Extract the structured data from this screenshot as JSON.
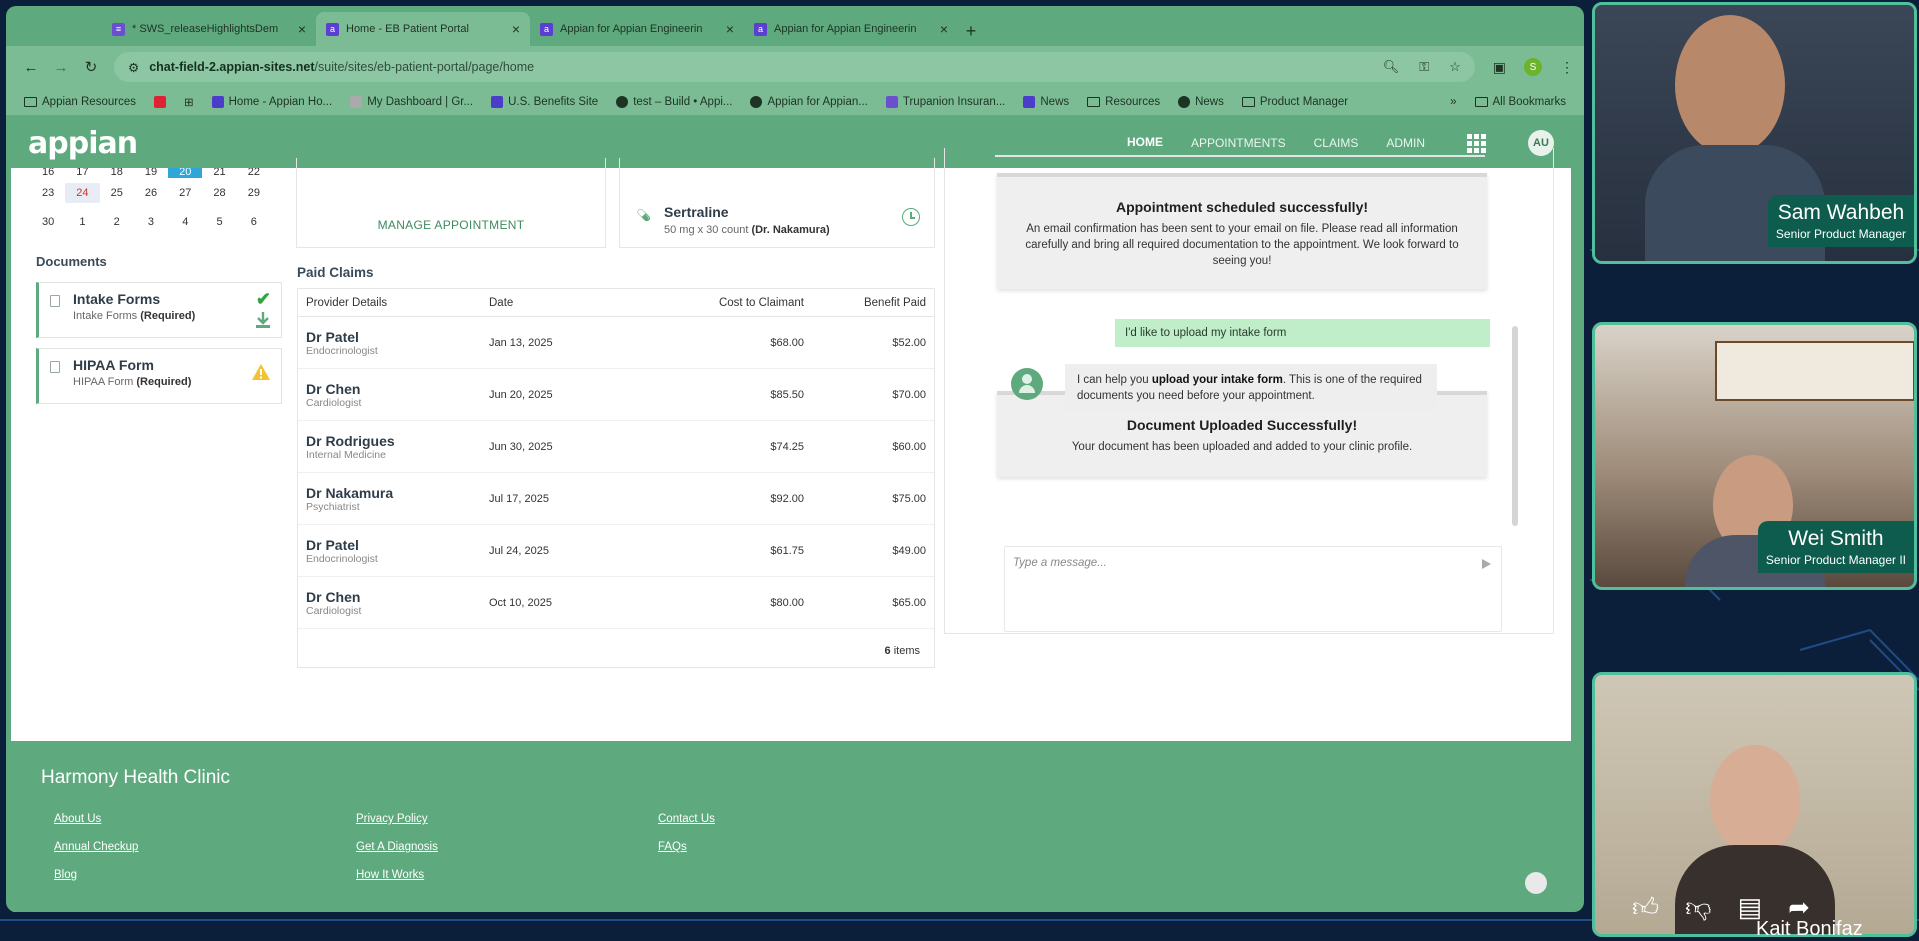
{
  "browser": {
    "tabs": [
      {
        "title": "* SWS_releaseHighlightsDem",
        "favicon": "doc-icon",
        "active": false
      },
      {
        "title": "Home - EB Patient Portal",
        "favicon": "appian-icon",
        "active": true
      },
      {
        "title": "Appian for Appian Engineerin",
        "favicon": "appian-icon",
        "active": false
      },
      {
        "title": "Appian for Appian Engineerin",
        "favicon": "appian-icon",
        "active": false
      }
    ],
    "url_host": "chat-field-2.appian-sites.net",
    "url_path": "/suite/sites/eb-patient-portal/page/home",
    "profile_initial": "S",
    "bookmarks": [
      "Appian Resources",
      "Home - Appian Ho...",
      "My Dashboard | Gr...",
      "U.S. Benefits Site",
      "test – Build • Appi...",
      "Appian for Appian...",
      "Trupanion Insuran...",
      "News",
      "Resources",
      "News",
      "Product Manager"
    ],
    "all_bookmarks": "All Bookmarks",
    "more_bookmarks": "»"
  },
  "app": {
    "logo": "appian",
    "nav": [
      {
        "label": "HOME",
        "active": true
      },
      {
        "label": "APPOINTMENTS",
        "active": false
      },
      {
        "label": "CLAIMS",
        "active": false
      },
      {
        "label": "ADMIN",
        "active": false
      }
    ],
    "avatar": "AU"
  },
  "calendar": {
    "partial_row": [
      "16",
      "17",
      "18",
      "19",
      "20",
      "21",
      "22"
    ],
    "rows": [
      [
        "23",
        "24",
        "25",
        "26",
        "27",
        "28",
        "29"
      ],
      [
        "30",
        "1",
        "2",
        "3",
        "4",
        "5",
        "6"
      ]
    ],
    "today": "24"
  },
  "documents": {
    "title": "Documents",
    "items": [
      {
        "name": "Intake Forms",
        "type": "Intake Forms",
        "required": "(Required)",
        "status": "complete"
      },
      {
        "name": "HIPAA Form",
        "type": "HIPAA Form",
        "required": "(Required)",
        "status": "warning"
      }
    ]
  },
  "appointment": {
    "manage_label": "MANAGE APPOINTMENT"
  },
  "medication": {
    "name": "Sertraline",
    "dosage": "50 mg x 30 count",
    "doctor": "(Dr. Nakamura)"
  },
  "claims": {
    "title": "Paid Claims",
    "headers": [
      "Provider Details",
      "Date",
      "Cost to Claimant",
      "Benefit Paid"
    ],
    "rows": [
      {
        "provider": "Dr Patel",
        "specialty": "Endocrinologist",
        "date": "Jan 13, 2025",
        "cost": "$68.00",
        "benefit": "$52.00"
      },
      {
        "provider": "Dr Chen",
        "specialty": "Cardiologist",
        "date": "Jun 20, 2025",
        "cost": "$85.50",
        "benefit": "$70.00"
      },
      {
        "provider": "Dr Rodrigues",
        "specialty": "Internal Medicine",
        "date": "Jun 30, 2025",
        "cost": "$74.25",
        "benefit": "$60.00"
      },
      {
        "provider": "Dr Nakamura",
        "specialty": "Psychiatrist",
        "date": "Jul 17, 2025",
        "cost": "$92.00",
        "benefit": "$75.00"
      },
      {
        "provider": "Dr Patel",
        "specialty": "Endocrinologist",
        "date": "Jul 24, 2025",
        "cost": "$61.75",
        "benefit": "$49.00"
      },
      {
        "provider": "Dr Chen",
        "specialty": "Cardiologist",
        "date": "Oct 10, 2025",
        "cost": "$80.00",
        "benefit": "$65.00"
      }
    ],
    "count": "6",
    "count_label": "items"
  },
  "chat": {
    "scheduled_title": "Appointment scheduled successfully!",
    "scheduled_text": "An email confirmation has been sent to your email on file.  Please read all information carefully and bring all required documentation to the appointment.  We look forward to seeing you!",
    "user_message": "I'd like to upload my intake form",
    "bot_pre": "I can help you ",
    "bot_bold": "upload your intake form",
    "bot_post": ". This is one of the required documents you need before your appointment.",
    "uploaded_title": "Document Uploaded Successfully!",
    "uploaded_text": "Your document has been uploaded and added to your clinic profile.",
    "input_placeholder": "Type a message..."
  },
  "footer": {
    "clinic": "Harmony Health Clinic",
    "links": [
      "About Us",
      "Privacy Policy",
      "Contact Us",
      "Annual Checkup",
      "Get A Diagnosis",
      "FAQs",
      "Blog",
      "How It Works"
    ]
  },
  "participants": [
    {
      "name": "Sam Wahbeh",
      "role": "Senior Product Manager"
    },
    {
      "name": "Wei Smith",
      "role": "Senior Product Manager II"
    },
    {
      "name": "Kait Bonifaz",
      "role": ""
    }
  ],
  "colors": {
    "brand_green": "#5ea97d",
    "tile_border": "#4fbf9c",
    "nameplate": "#0e5c4e",
    "background": "#0b1f3a"
  }
}
